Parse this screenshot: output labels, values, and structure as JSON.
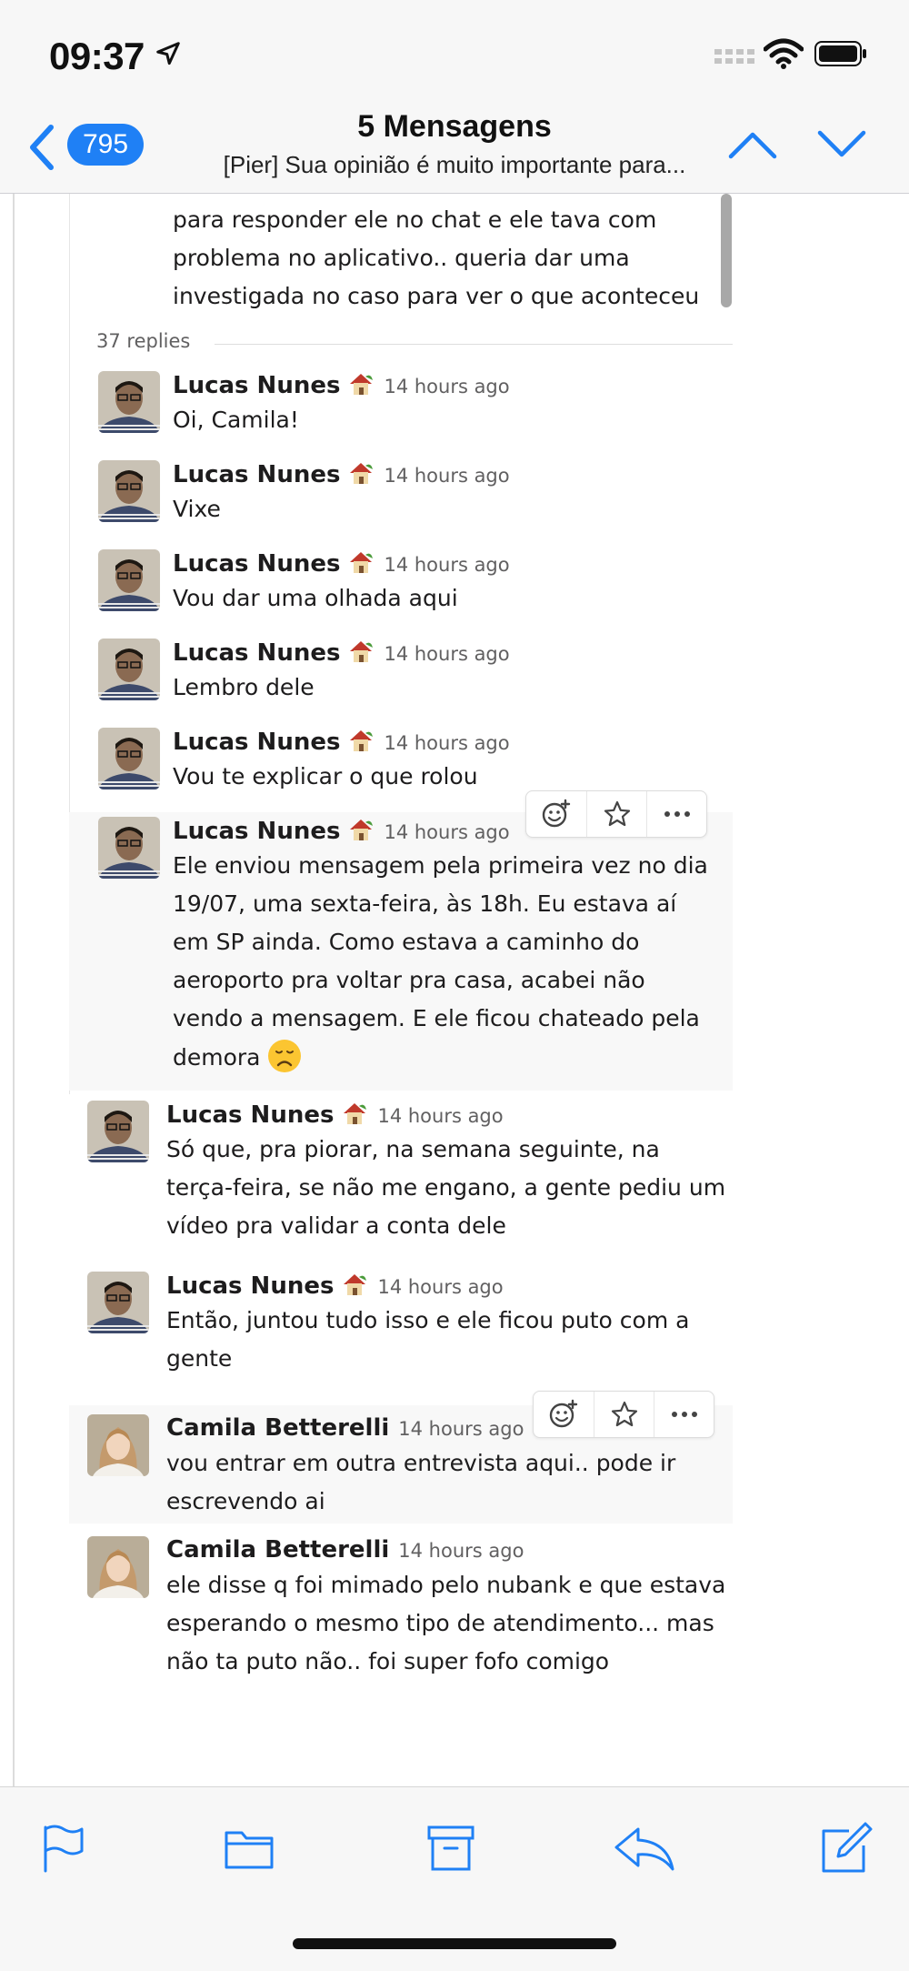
{
  "status_bar": {
    "time": "09:37",
    "icons": [
      "location-arrow-icon",
      "cellular-signal-icon",
      "wifi-icon",
      "battery-icon"
    ]
  },
  "nav_bar": {
    "back_icon": "chevron-left-icon",
    "unread_count": "795",
    "title": "5 Mensagens",
    "subtitle": "[Pier] Sua opinião é muito importante para...",
    "up_icon": "chevron-up-icon",
    "down_icon": "chevron-down-icon",
    "accent_color": "#1f80f5"
  },
  "thread": {
    "original_message": "para responder ele no chat e ele tava com problema no aplicativo.. queria dar uma investigada no caso para ver o que aconteceu",
    "replies_count_label": "37 replies",
    "messages": [
      {
        "author": "Lucas Nunes",
        "time": "14 hours ago",
        "text": "Oi, Camila!"
      },
      {
        "author": "Lucas Nunes",
        "time": "14 hours ago",
        "text": "Vixe"
      },
      {
        "author": "Lucas Nunes",
        "time": "14 hours ago",
        "text": "Vou dar uma olhada aqui"
      },
      {
        "author": "Lucas Nunes",
        "time": "14 hours ago",
        "text": "Lembro dele"
      },
      {
        "author": "Lucas Nunes",
        "time": "14 hours ago",
        "text": "Vou te explicar o que rolou"
      },
      {
        "author": "Lucas Nunes",
        "time": "14 hours ago",
        "text": "Ele enviou mensagem pela primeira vez no dia 19/07, uma sexta-feira, às 18h. Eu estava aí em SP ainda. Como estava a caminho do aeroporto pra voltar pra casa, acabei não vendo a mensagem. E ele ficou chateado pela demora",
        "emoji": "disappointed-face-icon"
      },
      {
        "author": "Lucas Nunes",
        "time": "14 hours ago",
        "text": "Só que, pra piorar, na semana seguinte, na terça-feira, se não me engano, a gente pediu um vídeo pra validar a conta dele"
      },
      {
        "author": "Lucas Nunes",
        "time": "14 hours ago",
        "text": "Então, juntou tudo isso e ele ficou puto com a gente"
      },
      {
        "author": "Camila Betterelli",
        "time": "14 hours ago",
        "text": "vou entrar em outra entrevista aqui.. pode ir escrevendo ai"
      },
      {
        "author": "Camila Betterelli",
        "time": "14 hours ago",
        "text": "ele disse q foi mimado pelo nubank e que estava esperando o mesmo tipo de atendimento... mas não ta puto não.. foi super fofo comigo"
      }
    ],
    "hover_actions": [
      "add-reaction-icon",
      "star-icon",
      "more-actions-icon"
    ]
  },
  "toolbar": {
    "buttons": [
      "flag-icon",
      "folder-icon",
      "archive-icon",
      "reply-icon",
      "compose-icon"
    ],
    "icon_color": "#1f80f5"
  }
}
